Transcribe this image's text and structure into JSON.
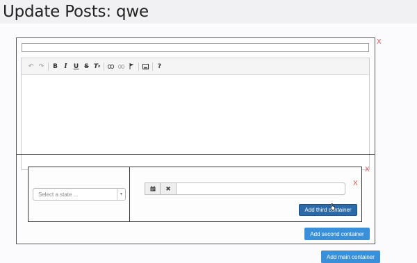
{
  "header": {
    "title": "Update Posts: qwe"
  },
  "main_container": {
    "remove_label": "X",
    "title_input": {
      "value": "",
      "placeholder": ""
    },
    "editor": {
      "toolbar": [
        {
          "name": "undo-icon",
          "glyph": "↶",
          "dim": true
        },
        {
          "name": "redo-icon",
          "glyph": "↷",
          "dim": true
        },
        {
          "name": "bold-icon",
          "glyph": "B"
        },
        {
          "name": "italic-icon",
          "glyph": "I"
        },
        {
          "name": "underline-icon",
          "glyph": "U"
        },
        {
          "name": "strikethrough-icon",
          "glyph": "S"
        },
        {
          "name": "clear-format-icon",
          "glyph": "Tx"
        },
        {
          "name": "link-icon",
          "glyph": "⚭"
        },
        {
          "name": "unlink-icon",
          "glyph": "⚮",
          "dim": true
        },
        {
          "name": "flag-icon",
          "glyph": "⚑"
        },
        {
          "name": "image-icon",
          "glyph": "▣"
        },
        {
          "name": "help-icon",
          "glyph": "?"
        }
      ]
    },
    "second_container": {
      "remove_label": "X",
      "state_select": {
        "placeholder": "Select a state ..."
      },
      "third_container": {
        "remove_label": "X",
        "calendar_icon": "calendar-icon",
        "clear_icon": "times-icon",
        "input_value": "",
        "add_third_label": "Add third container"
      }
    },
    "add_second_label": "Add second container"
  },
  "add_main_label": "Add main container",
  "colors": {
    "remove": "#d9534f",
    "primary_dark": "#2a6aa8",
    "primary": "#3a8fd9"
  }
}
